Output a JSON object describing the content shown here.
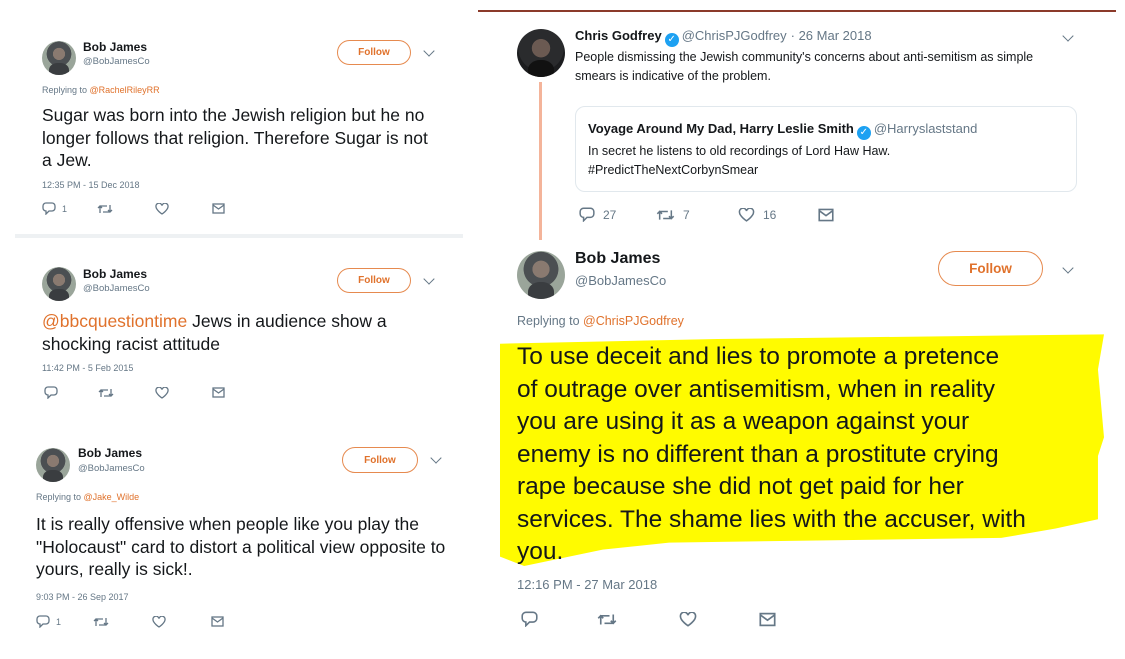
{
  "left_tweets": [
    {
      "name": "Bob James",
      "handle": "@BobJamesCo",
      "replying_prefix": "Replying to ",
      "replying_to": "@RachelRileyRR",
      "text": "Sugar was born into the Jewish religion but he no longer follows that religion. Therefore Sugar is not a Jew.",
      "timestamp": "12:35 PM - 15 Dec 2018",
      "follow_label": "Follow",
      "reply_count": "1"
    },
    {
      "name": "Bob James",
      "handle": "@BobJamesCo",
      "text_mention": "@bbcquestiontime",
      "text": " Jews in audience show a shocking racist attitude",
      "timestamp": "11:42 PM - 5 Feb 2015",
      "follow_label": "Follow"
    },
    {
      "name": "Bob James",
      "handle": "@BobJamesCo",
      "replying_prefix": "Replying to ",
      "replying_to": "@Jake_Wilde",
      "text": "It is really offensive when people like you play the \"Holocaust\" card to distort a political view opposite to yours, really is sick!.",
      "timestamp": "9:03 PM - 26 Sep 2017",
      "follow_label": "Follow",
      "reply_count": "1"
    }
  ],
  "right_thread": {
    "parent": {
      "name": "Chris Godfrey",
      "handle": "@ChrisPJGodfrey",
      "date": "· 26 Mar 2018",
      "text": "People dismissing the Jewish community's concerns about anti-semitism as simple smears is indicative of the problem.",
      "quote": {
        "name": "Voyage Around My Dad, Harry Leslie Smith",
        "handle": "@Harryslaststand",
        "line1": "In secret he listens to old recordings of Lord Haw Haw.",
        "line2": "#PredictTheNextCorbynSmear"
      },
      "reply_count": "27",
      "retweet_count": "7",
      "like_count": "16"
    },
    "main": {
      "name": "Bob James",
      "handle": "@BobJamesCo",
      "follow_label": "Follow",
      "replying_prefix": "Replying to ",
      "replying_to": "@ChrisPJGodfrey",
      "text_lines": [
        "To use deceit and lies to promote a pretence",
        "of outrage over antisemitism, when in reality",
        "you are using it as a weapon against your",
        "enemy is no different than a prostitute crying",
        "rape because she did not get paid for her",
        "services. The shame lies with the accuser, with",
        "you."
      ],
      "timestamp": "12:16 PM - 27 Mar 2018"
    }
  },
  "colors": {
    "accent": "#e0722c",
    "highlight": "#fffb00",
    "verified": "#1da1f2",
    "thread_line": "#f4b49a",
    "top_border": "#8b3a2a"
  }
}
